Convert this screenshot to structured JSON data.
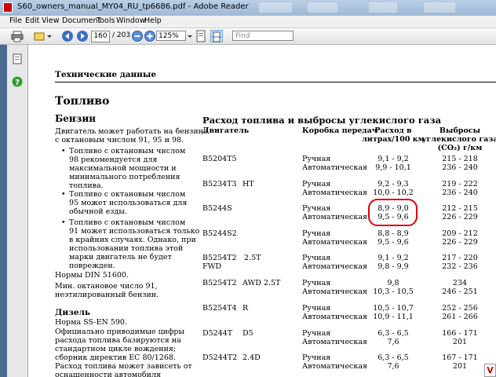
{
  "window": {
    "title": "S60_owners_manual_MY04_RU_tp6686.pdf - Adobe Reader"
  },
  "menu": [
    "File",
    "Edit",
    "View",
    "Document",
    "Tools",
    "Window",
    "Help"
  ],
  "toolbar": {
    "page_current": "160",
    "page_total": "/ 203",
    "zoom": "125%",
    "find_placeholder": "Find"
  },
  "doc": {
    "header": "Технические данные",
    "section_title": "Топливо",
    "benzin_title": "Бензин",
    "benzin_intro": [
      "Двигатель может работать на бензине",
      "с октановым числом 91, 95 и 98."
    ],
    "bullet1": [
      "Топливо с октановым числом",
      "98 рекомендуется для",
      "максимальной мощности и",
      "минимального потребления",
      "топлива."
    ],
    "bullet2": [
      "Топливо с октановым числом",
      "95 может использоваться для",
      "обычной езды."
    ],
    "bullet3": [
      "Топливо с октановым числом",
      "91 может использоваться только",
      "в крайних случаях. Однако, при",
      "использовании топлива этой",
      "марки двигатель не будет",
      "поврежден."
    ],
    "norms": "Нормы DIN 51600.",
    "min_oct": [
      "Мин. октановое число 91,",
      "неэтилированный бензин."
    ],
    "diesel_title": "Дизель",
    "diesel_norm": "Норма SS-EN 590.",
    "diesel_text": [
      "Официально приводимые цифры",
      "расхода топлива базируются на",
      "стандартном цикле вождения;",
      "сборник директив ЕС 80/1268.",
      "Расход топлива может зависеть от",
      "оснащенности автомобиля"
    ],
    "table_title": "Расход топлива и выбросы углекислого газа",
    "col_engine": "Двигатель",
    "col_gearbox": "Коробка передач",
    "col_consumption": [
      "Расход в",
      "литрах/100 км"
    ],
    "col_emission": [
      "Выбросы",
      "углекислого газа",
      "(CO₂) г/км"
    ],
    "rows": [
      {
        "engine": "B5204T5",
        "extra": "",
        "gear1": "Ручная",
        "gear2": "Автоматическая",
        "cons1": "9,1 - 9,2",
        "cons2": "9,9 - 10,1",
        "emis1": "215 - 218",
        "emis2": "236 - 240"
      },
      {
        "engine": "B5234T3",
        "extra": "HT",
        "gear1": "Ручная",
        "gear2": "Автоматическая",
        "cons1": "9,2 - 9,3",
        "cons2": "10,0 - 10,2",
        "emis1": "219 - 222",
        "emis2": "236 - 240"
      },
      {
        "engine": "B5244S",
        "extra": "",
        "gear1": "Ручная",
        "gear2": "Автоматическая",
        "cons1": "8,9 - 9,0",
        "cons2": "9,5 - 9,6",
        "emis1": "212 - 215",
        "emis2": "226 - 229"
      },
      {
        "engine": "B5244S2",
        "extra": "",
        "gear1": "Ручная",
        "gear2": "Автоматическая",
        "cons1": "8,8 - 8,9",
        "cons2": "9,5 - 9,6",
        "emis1": "209 - 212",
        "emis2": "226 - 229"
      },
      {
        "engine": "B5254T2",
        "extra": "2.5T",
        "engine2": "FWD",
        "gear1": "Ручная",
        "gear2": "Автоматическая",
        "cons1": "9,1 - 9,2",
        "cons2": "9,8 - 9,9",
        "emis1": "217 - 220",
        "emis2": "232 - 236"
      },
      {
        "engine": "B5254T2",
        "extra": "AWD 2.5T",
        "gear1": "Ручная",
        "gear2": "Автоматическая",
        "cons1": "9,8",
        "cons2": "10,3 - 10,5",
        "emis1": "234",
        "emis2": "246 - 251"
      },
      {
        "engine": "B5254T4",
        "extra": "R",
        "gear1": "Ручная",
        "gear2": "Автоматическая",
        "cons1": "10,5 - 10,7",
        "cons2": "10,9 - 11,1",
        "emis1": "252 - 256",
        "emis2": "261 - 266"
      },
      {
        "engine": "D5244T",
        "extra": "D5",
        "gear1": "Ручная",
        "gear2": "Автоматическая",
        "cons1": "6,3 - 6,5",
        "cons2": "7,6",
        "emis1": "166 - 171",
        "emis2": "201"
      },
      {
        "engine": "D5244T2",
        "extra": "2.4D",
        "gear1": "Ручная",
        "gear2": "Автоматическая",
        "cons1": "6,3 - 6,5",
        "cons2": "7,6",
        "emis1": "167 - 171",
        "emis2": "201"
      }
    ]
  }
}
